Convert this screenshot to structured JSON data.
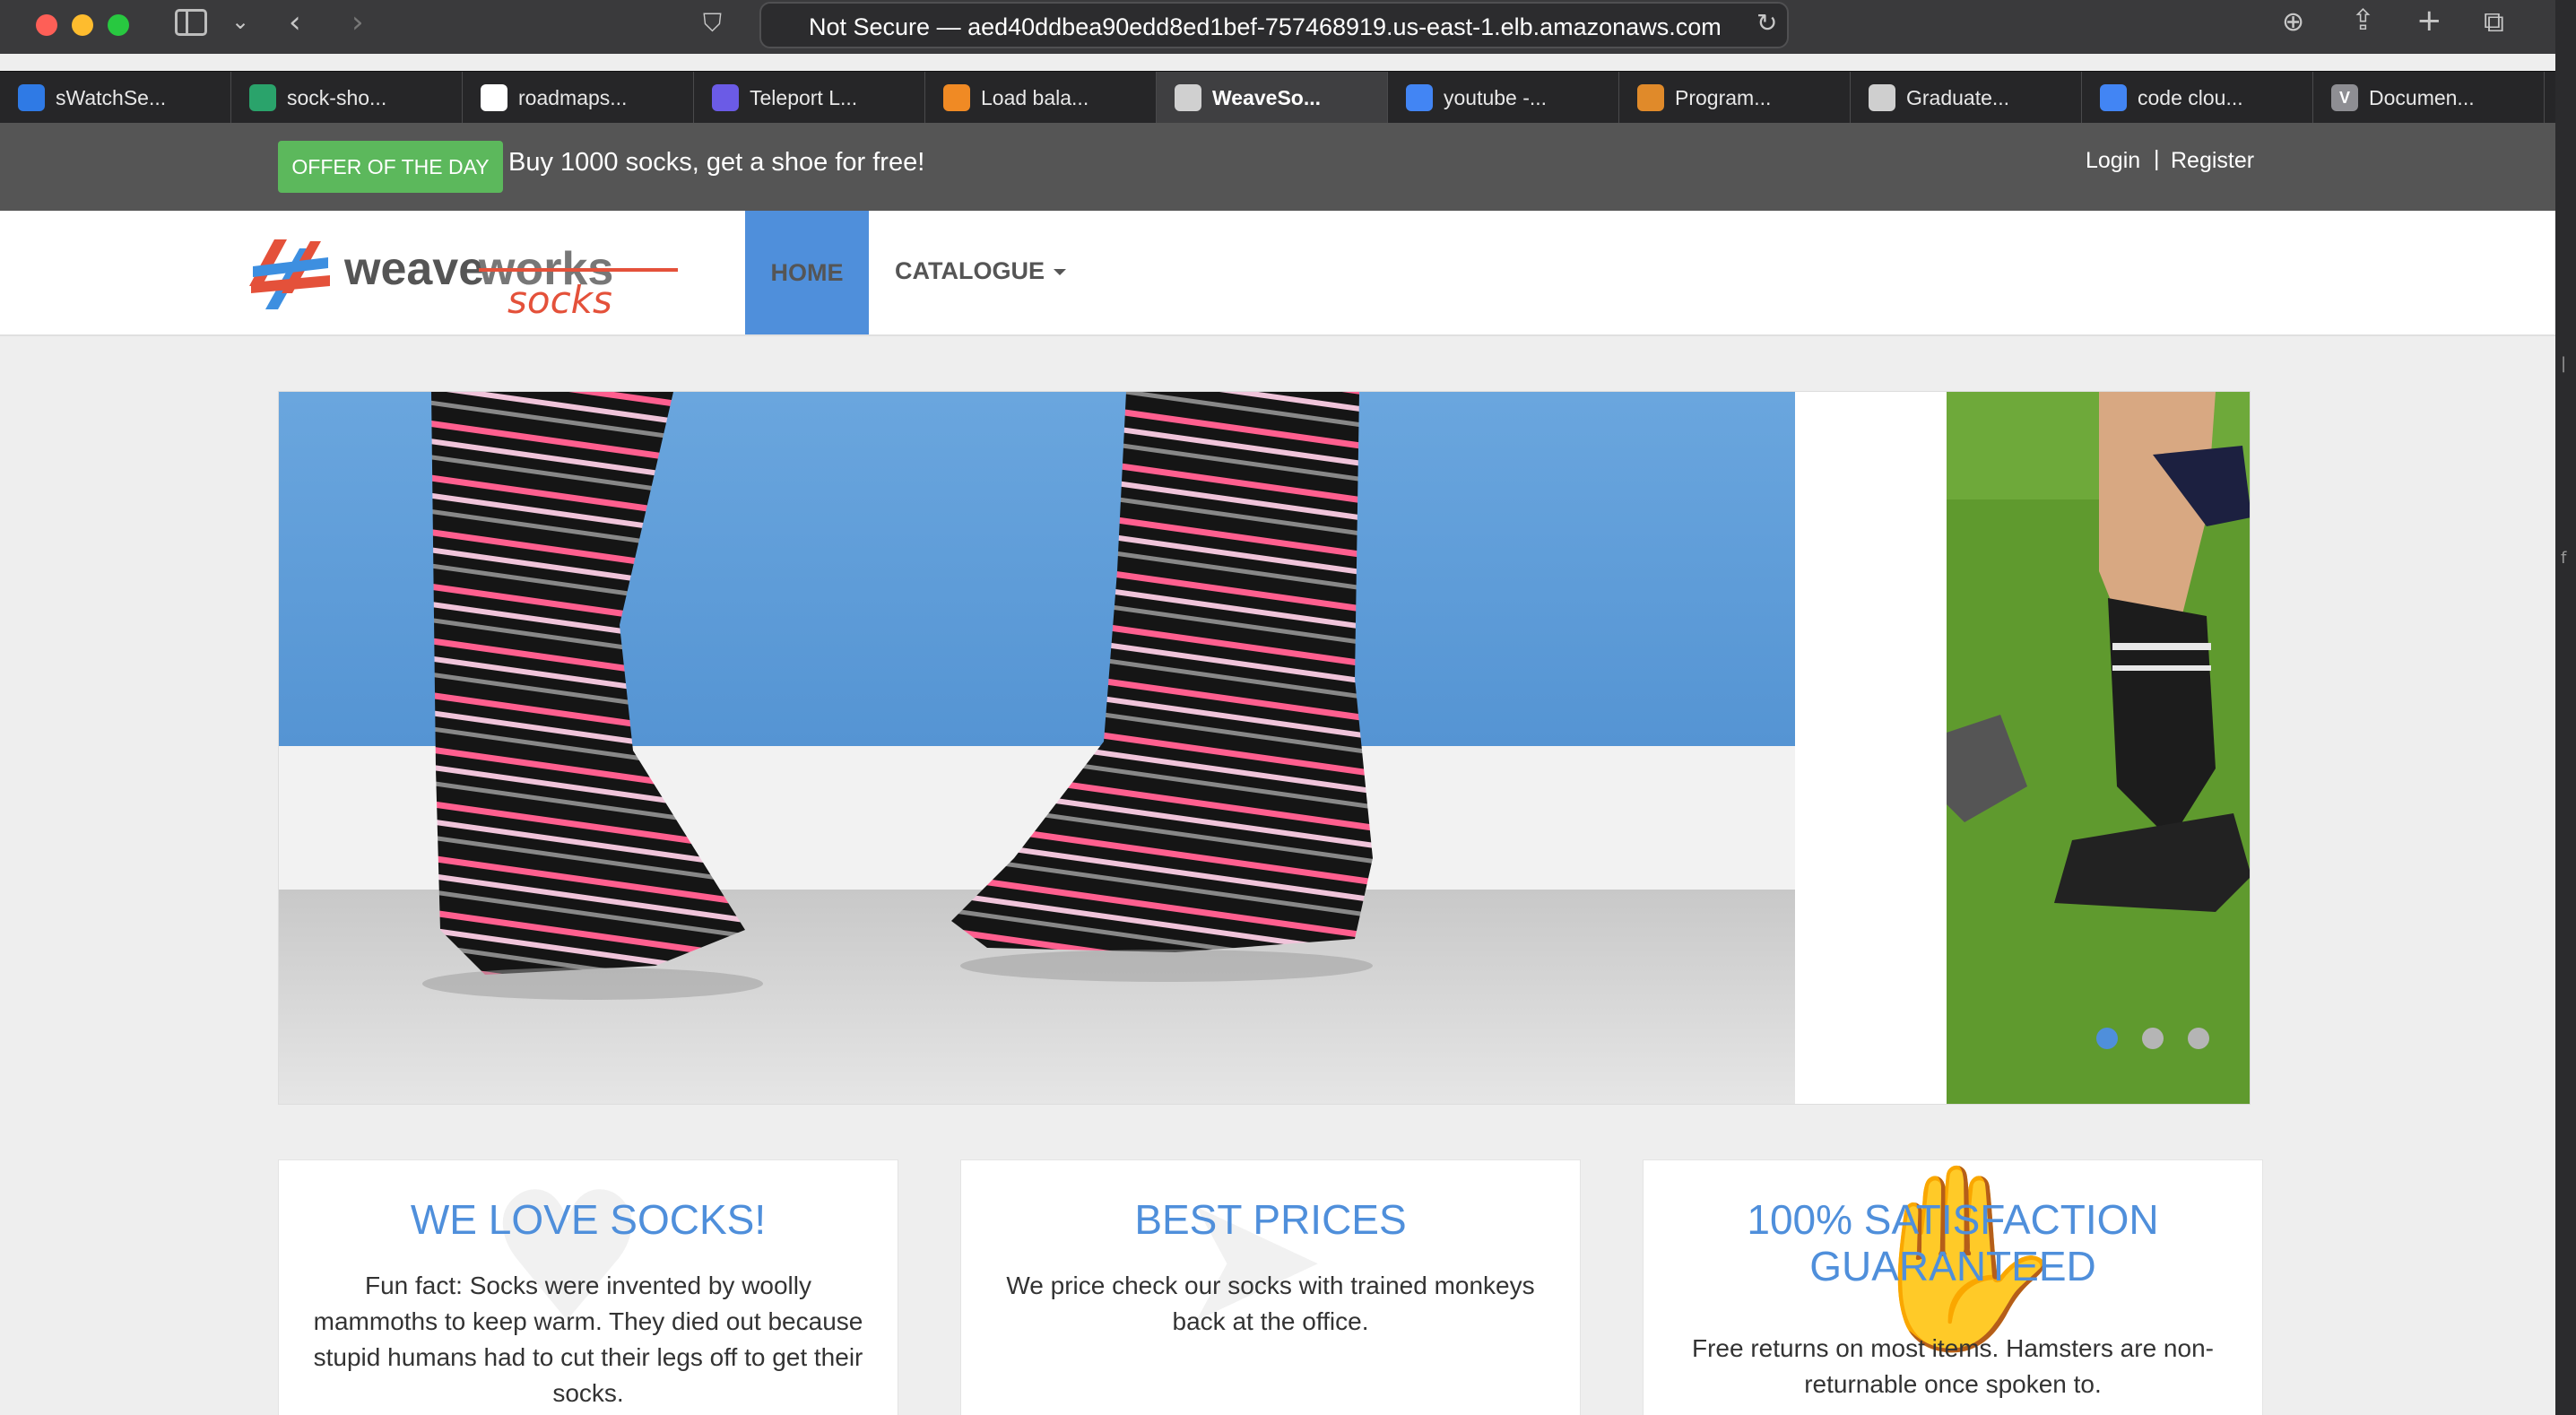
{
  "browser": {
    "address_text": "Not Secure — aed40ddbea90edd8ed1bef-757468919.us-east-1.elb.amazonaws.com",
    "tabs": [
      {
        "label": "sWatchSe...",
        "icon": "bar-chart-icon",
        "color": "#2f7ae5"
      },
      {
        "label": "sock-sho...",
        "icon": "circle-arrow-icon",
        "color": "#2aa36b"
      },
      {
        "label": "roadmaps...",
        "icon": "github-icon",
        "color": "#ffffff"
      },
      {
        "label": "Teleport L...",
        "icon": "teleport-icon",
        "color": "#6b5be6"
      },
      {
        "label": "Load bala...",
        "icon": "aws-cube-icon",
        "color": "#f08a24"
      },
      {
        "label": "WeaveSo...",
        "icon": "weave-icon",
        "color": "#d0d0d0",
        "active": true
      },
      {
        "label": "youtube -...",
        "icon": "google-icon",
        "color": "#4285f4"
      },
      {
        "label": "Program...",
        "icon": "gear-icon",
        "color": "#e08a2a"
      },
      {
        "label": "Graduate...",
        "icon": "graduate-icon",
        "color": "#cfcfcf"
      },
      {
        "label": "code clou...",
        "icon": "google-icon",
        "color": "#4285f4"
      },
      {
        "label": "Documen...",
        "icon": "v-icon",
        "color": "#8e8e93",
        "letter": "V"
      }
    ]
  },
  "site": {
    "offer_badge": "OFFER OF THE DAY",
    "offer_text": "Buy 1000 socks, get a shoe for free!",
    "login": "Login",
    "separator": "|",
    "register": "Register",
    "nav": {
      "home": "HOME",
      "catalogue": "CATALOGUE"
    },
    "logo": {
      "word1": "weave",
      "word2": "works",
      "word3": "socks"
    },
    "accent": "#4f8fdb",
    "carousel": {
      "slide_count": 3,
      "active_index": 0
    },
    "features": [
      {
        "title": "WE LOVE SOCKS!",
        "text": "Fun fact: Socks were invented by woolly mammoths to keep warm. They died out because stupid humans had to cut their legs off to get their socks.",
        "icon": "heart-icon"
      },
      {
        "title": "BEST PRICES",
        "text": "We price check our socks with trained monkeys back at the office.",
        "icon": "tag-icon"
      },
      {
        "title": "100% SATISFACTION GUARANTEED",
        "text": "Free returns on most items. Hamsters are non-returnable once spoken to.",
        "icon": "thumbs-up-icon"
      }
    ]
  }
}
